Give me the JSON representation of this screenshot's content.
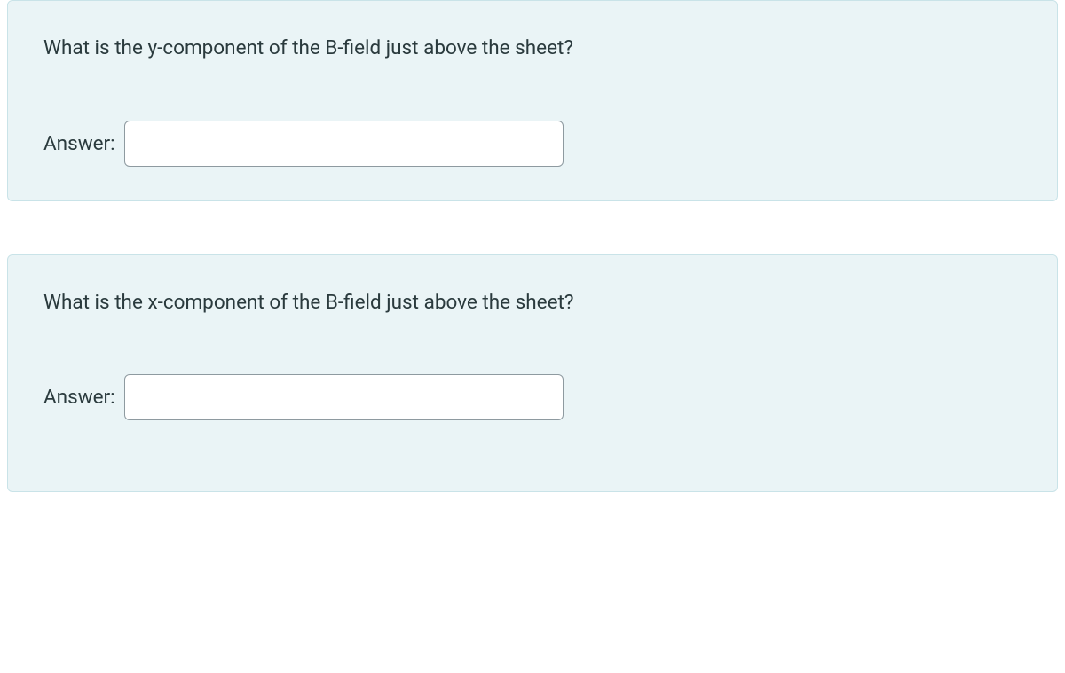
{
  "questions": [
    {
      "prompt": "What is the y-component of the B-field just above the sheet?",
      "answer_label": "Answer:",
      "answer_value": ""
    },
    {
      "prompt": "What is the x-component of the B-field just above the sheet?",
      "answer_label": "Answer:",
      "answer_value": ""
    }
  ]
}
